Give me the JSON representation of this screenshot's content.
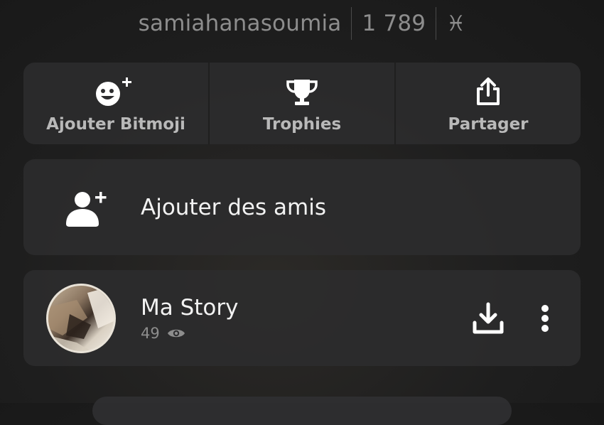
{
  "header": {
    "username": "samiahanasoumia",
    "score": "1 789",
    "zodiac": "♓"
  },
  "actions": [
    {
      "label": "Ajouter Bitmoji",
      "icon": "add-bitmoji-icon"
    },
    {
      "label": "Trophies",
      "icon": "trophy-icon"
    },
    {
      "label": "Partager",
      "icon": "share-icon"
    }
  ],
  "friends": {
    "label": "Ajouter des amis",
    "icon": "add-friend-icon"
  },
  "story": {
    "title": "Ma Story",
    "views": "49",
    "icons": [
      "eye-icon",
      "download-icon",
      "more-options-icon"
    ]
  },
  "colors": {
    "background": "#1e1e1e",
    "card": "#2c2c2e",
    "muted_text": "#8d8d8d",
    "primary_text": "#ffffff"
  }
}
